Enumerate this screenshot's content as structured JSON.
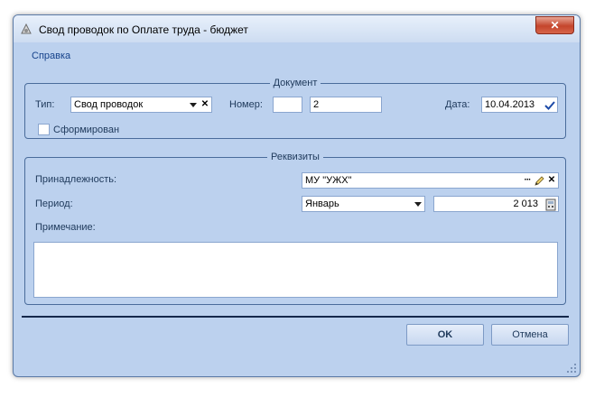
{
  "window": {
    "title": "Свод проводок по Оплате труда - бюджет",
    "close_label": "✕"
  },
  "menu": {
    "items": [
      "Справка"
    ]
  },
  "document": {
    "legend": "Документ",
    "type_label": "Тип:",
    "type_value": "Свод проводок",
    "number_label": "Номер:",
    "number_prefix": "",
    "number_value": "2",
    "date_label": "Дата:",
    "date_value": "10.04.2013",
    "formed_label": "Сформирован",
    "formed_checked": false
  },
  "details": {
    "legend": "Реквизиты",
    "belonging_label": "Принадлежность:",
    "belonging_value": "МУ \"УЖХ\"",
    "period_label": "Период:",
    "period_month": "Январь",
    "period_year": "2 013",
    "note_label": "Примечание:",
    "note_value": ""
  },
  "buttons": {
    "ok": "OK",
    "cancel": "Отмена"
  },
  "colors": {
    "window_bg": "#bcd1ee",
    "border": "#4a6c9b",
    "separator": "#15284b",
    "close": "#c4452c"
  }
}
